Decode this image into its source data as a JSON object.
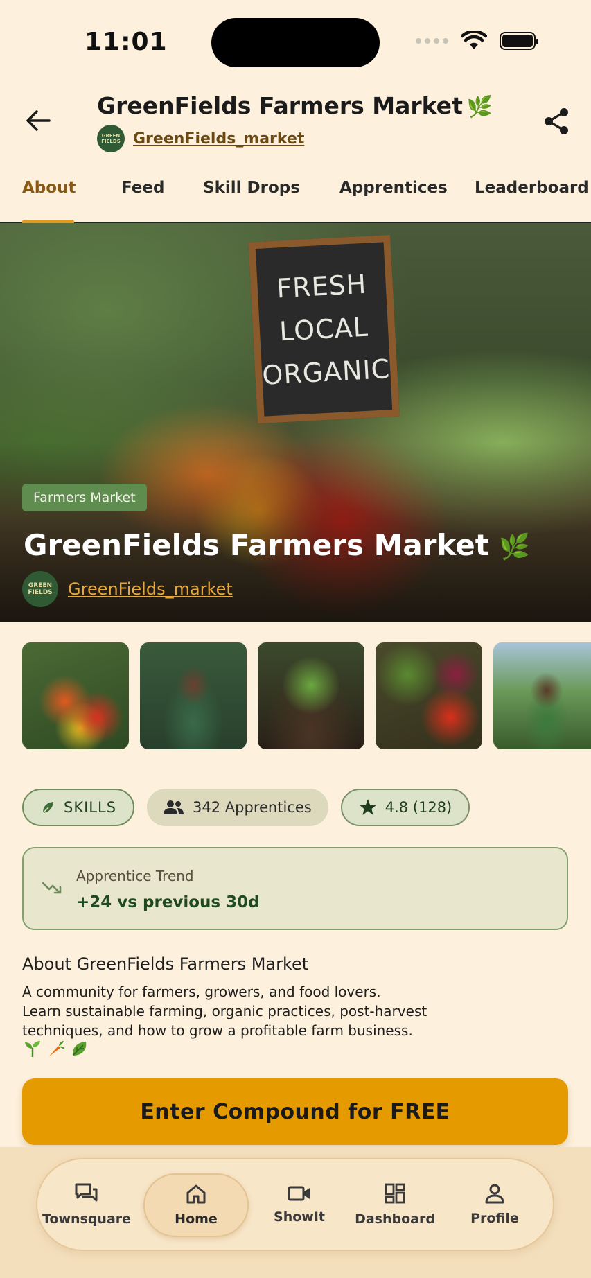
{
  "status_bar": {
    "time": "11:01"
  },
  "header": {
    "title": "GreenFields Farmers Market",
    "title_emoji": "🌿",
    "handle": "GreenFields_market",
    "avatar_text": "GREEN FIELDS"
  },
  "tabs": [
    {
      "label": "About",
      "active": true
    },
    {
      "label": "Feed",
      "active": false
    },
    {
      "label": "Skill Drops",
      "active": false
    },
    {
      "label": "Apprentices",
      "active": false
    },
    {
      "label": "Leaderboard",
      "active": false
    }
  ],
  "hero": {
    "chalkboard": [
      "FRESH",
      "LOCAL",
      "ORGANIC"
    ],
    "badge": "Farmers Market",
    "title": "GreenFields Farmers Market",
    "title_emoji": "🌿",
    "handle": "GreenFields_market",
    "avatar_text": "GREEN FIELDS"
  },
  "gallery": {
    "items": [
      "vegetable-stall",
      "vendor-with-basket",
      "hands-holding-plant",
      "produce-baskets",
      "farmer-with-crate"
    ]
  },
  "chips": {
    "skills": "SKILLS",
    "apprentices": "342 Apprentices",
    "rating": "4.8 (128)"
  },
  "trend": {
    "label": "Apprentice Trend",
    "value": "+24 vs previous 30d"
  },
  "about": {
    "title": "About GreenFields Farmers Market",
    "line1": "A community for farmers, growers, and food lovers.",
    "line2": "Learn sustainable farming, organic practices, post-harvest",
    "line3": "techniques, and how to grow a profitable farm business.",
    "emojis": [
      "🌱",
      "🥕",
      "🥬"
    ]
  },
  "cta": {
    "label": "Enter Compound for FREE"
  },
  "nav": [
    {
      "label": "Townsquare",
      "icon": "chat-icon"
    },
    {
      "label": "Home",
      "icon": "home-icon",
      "active": true
    },
    {
      "label": "ShowIt",
      "icon": "video-icon"
    },
    {
      "label": "Dashboard",
      "icon": "dashboard-icon"
    },
    {
      "label": "Profile",
      "icon": "profile-icon"
    }
  ],
  "colors": {
    "background": "#fdf0dc",
    "accent": "#e59a00",
    "active_tab": "#8a5a14",
    "green": "#5f8c4f"
  }
}
